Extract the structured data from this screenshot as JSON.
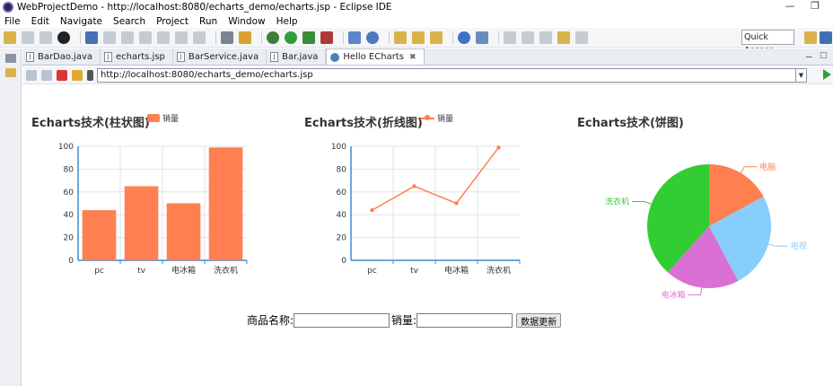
{
  "window": {
    "title": "WebProjectDemo - http://localhost:8080/echarts_demo/echarts.jsp - Eclipse IDE"
  },
  "menu": {
    "items": [
      "File",
      "Edit",
      "Navigate",
      "Search",
      "Project",
      "Run",
      "Window",
      "Help"
    ]
  },
  "toolbar": {
    "quick_access": "Quick Access"
  },
  "tabs": [
    {
      "label": "BarDao.java",
      "active": false
    },
    {
      "label": "echarts.jsp",
      "active": false
    },
    {
      "label": "BarService.java",
      "active": false
    },
    {
      "label": "Bar.java",
      "active": false
    },
    {
      "label": "Hello ECharts",
      "active": true
    }
  ],
  "browser": {
    "url": "http://localhost:8080/echarts_demo/echarts.jsp"
  },
  "charts": {
    "bar_title": "Echarts技术(柱状图)",
    "line_title": "Echarts技术(折线图)",
    "pie_title": "Echarts技术(饼图)",
    "legend_label": "销量",
    "color": "#ff7f50"
  },
  "chart_data": [
    {
      "type": "bar",
      "title": "Echarts技术(柱状图)",
      "categories": [
        "pc",
        "tv",
        "电冰箱",
        "洗衣机"
      ],
      "series": [
        {
          "name": "销量",
          "values": [
            44,
            65,
            50,
            99
          ]
        }
      ],
      "ylim": [
        0,
        100
      ],
      "yticks": [
        0,
        20,
        40,
        60,
        80,
        100
      ],
      "legend": "top-center",
      "grid": true
    },
    {
      "type": "line",
      "title": "Echarts技术(折线图)",
      "categories": [
        "pc",
        "tv",
        "电冰箱",
        "洗衣机"
      ],
      "series": [
        {
          "name": "销量",
          "values": [
            44,
            65,
            50,
            99
          ]
        }
      ],
      "ylim": [
        0,
        100
      ],
      "yticks": [
        0,
        20,
        40,
        60,
        80,
        100
      ],
      "legend": "top-center",
      "grid": true
    },
    {
      "type": "pie",
      "title": "Echarts技术(饼图)",
      "slices": [
        {
          "label": "电脑",
          "value": 44,
          "color": "#ff7f50"
        },
        {
          "label": "电视",
          "value": 65,
          "color": "#87cefa"
        },
        {
          "label": "电冰箱",
          "value": 50,
          "color": "#da70d6"
        },
        {
          "label": "洗衣机",
          "value": 99,
          "color": "#32cd32"
        }
      ]
    }
  ],
  "form": {
    "name_label": "商品名称:",
    "sales_label": "销量:",
    "name_value": "",
    "sales_value": "",
    "submit_label": "数据更新"
  }
}
